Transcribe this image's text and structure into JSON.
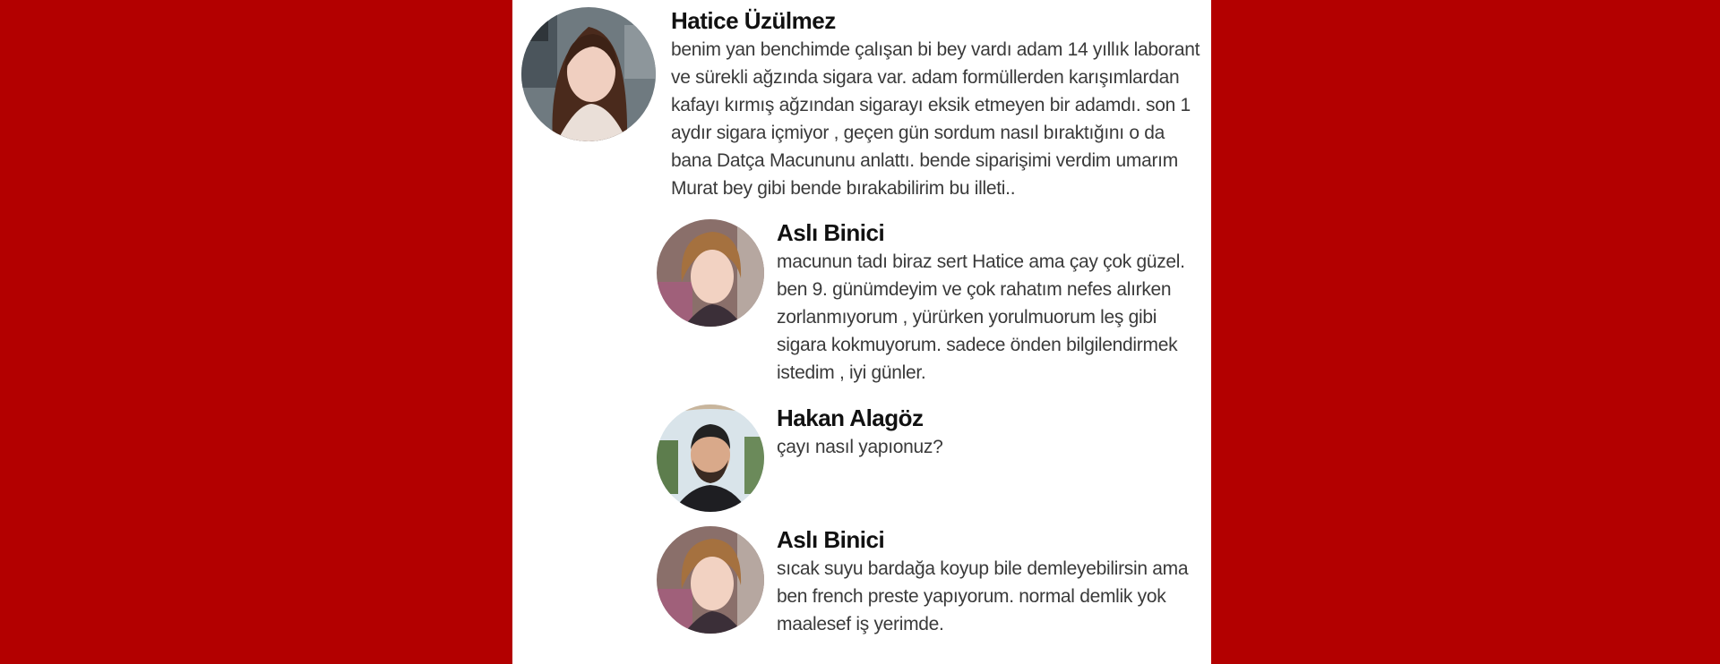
{
  "comments": [
    {
      "name": "Hatice Üzülmez",
      "avatar": "avatar-woman-brown-hair",
      "text": "benim yan benchimde çalışan bi bey vardı adam 14 yıllık laborant ve sürekli ağzında sigara var. adam formüllerden karışımlardan kafayı kırmış ağzından sigarayı eksik etmeyen bir adamdı. son 1 aydır sigara içmiyor , geçen gün sordum nasıl bıraktığını o da bana Datça Macununu anlattı. bende siparişimi verdim umarım Murat bey gibi bende bırakabilirim bu illeti.."
    },
    {
      "name": "Aslı Binici",
      "avatar": "avatar-woman-short-hair",
      "text": "macunun tadı biraz sert Hatice ama çay çok güzel. ben 9. günümdeyim ve çok rahatım nefes alırken zorlanmıyorum , yürürken yorulmuorum leş gibi sigara kokmuyorum. sadece önden bilgilendirmek istedim , iyi günler."
    },
    {
      "name": "Hakan Alagöz",
      "avatar": "avatar-man-beard",
      "text": "çayı nasıl yapıonuz?"
    },
    {
      "name": "Aslı Binici",
      "avatar": "avatar-woman-short-hair",
      "text": "sıcak suyu bardağa koyup bile demleyebilirsin ama ben french preste yapıyorum. normal demlik yok maalesef iş yerimde."
    }
  ]
}
